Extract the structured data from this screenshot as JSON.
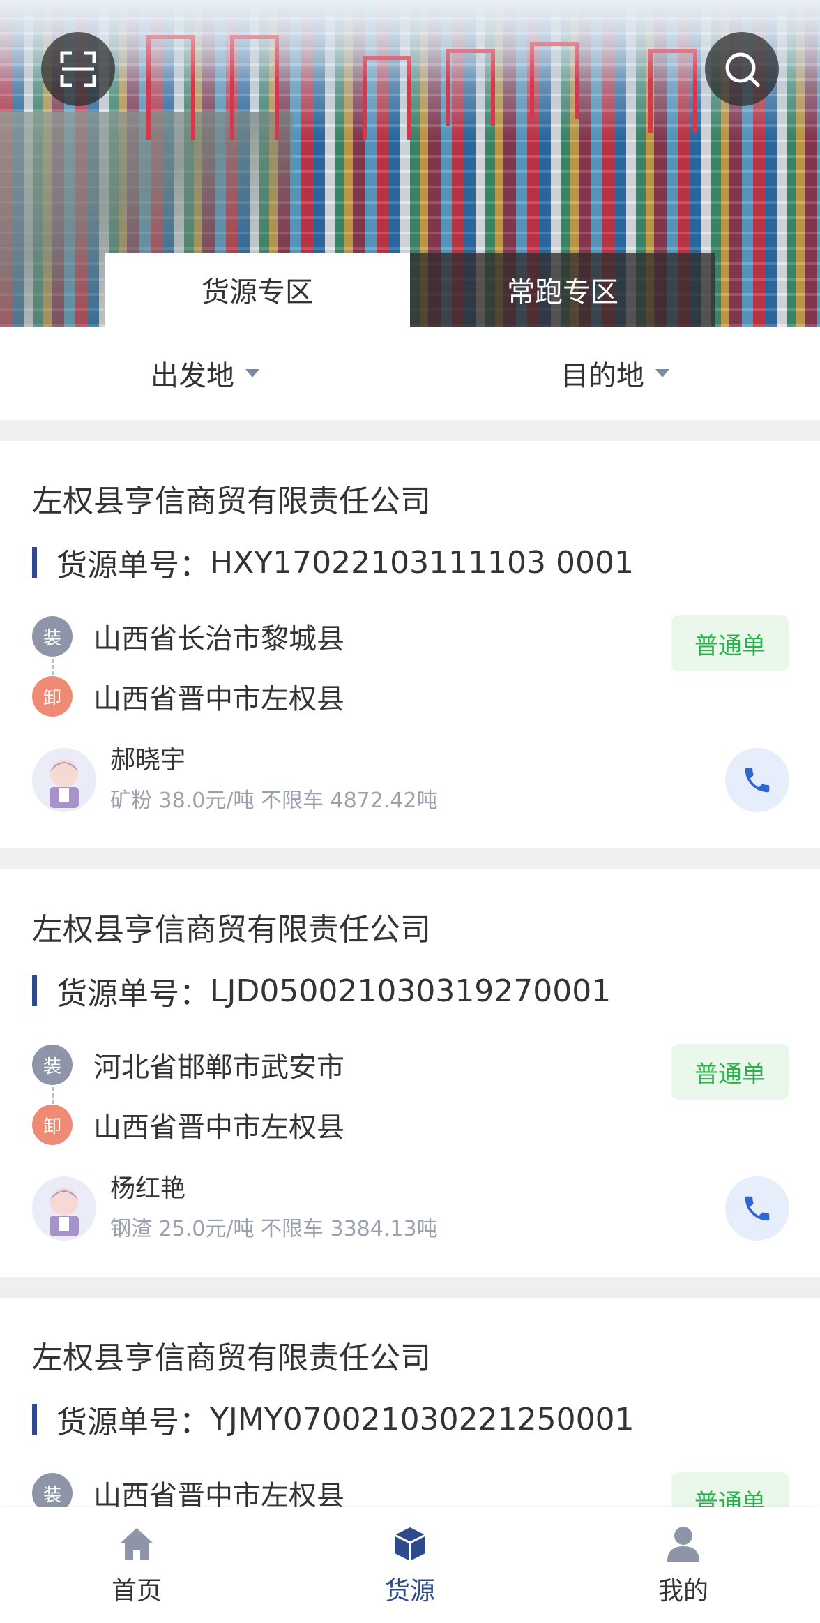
{
  "header": {
    "scan_icon": "scan-icon",
    "search_icon": "search-icon",
    "tabs": [
      {
        "label": "货源专区",
        "active": true
      },
      {
        "label": "常跑专区",
        "active": false
      }
    ]
  },
  "filters": {
    "origin_label": "出发地",
    "destination_label": "目的地"
  },
  "cards": [
    {
      "company": "左权县亨信商贸有限责任公司",
      "order_prefix": "货源单号：",
      "order_no": "HXY17022103111103 0001",
      "load_badge": "装",
      "load_place": "山西省长治市黎城县",
      "unload_badge": "卸",
      "unload_place": "山西省晋中市左权县",
      "tag": "普通单",
      "person": "郝晓宇",
      "cargo": "矿粉 38.0元/吨 不限车 4872.42吨"
    },
    {
      "company": "左权县亨信商贸有限责任公司",
      "order_prefix": "货源单号：",
      "order_no": "LJD050021030319270001",
      "load_badge": "装",
      "load_place": "河北省邯郸市武安市",
      "unload_badge": "卸",
      "unload_place": "山西省晋中市左权县",
      "tag": "普通单",
      "person": "杨红艳",
      "cargo": "钢渣 25.0元/吨 不限车 3384.13吨"
    },
    {
      "company": "左权县亨信商贸有限责任公司",
      "order_prefix": "货源单号：",
      "order_no": "YJMY070021030221250001",
      "load_badge": "装",
      "load_place": "山西省晋中市左权县",
      "tag": "普通单"
    }
  ],
  "bottom_nav": [
    {
      "label": "首页",
      "icon": "home-icon",
      "active": false
    },
    {
      "label": "货源",
      "icon": "cube-icon",
      "active": true
    },
    {
      "label": "我的",
      "icon": "user-icon",
      "active": false
    }
  ],
  "colors": {
    "accent": "#2d4a8c",
    "tag_green": "#2bb24c",
    "tag_bg": "#e9f8ea",
    "load_badge": "#8f95a8",
    "unload_badge": "#ef8a74"
  }
}
